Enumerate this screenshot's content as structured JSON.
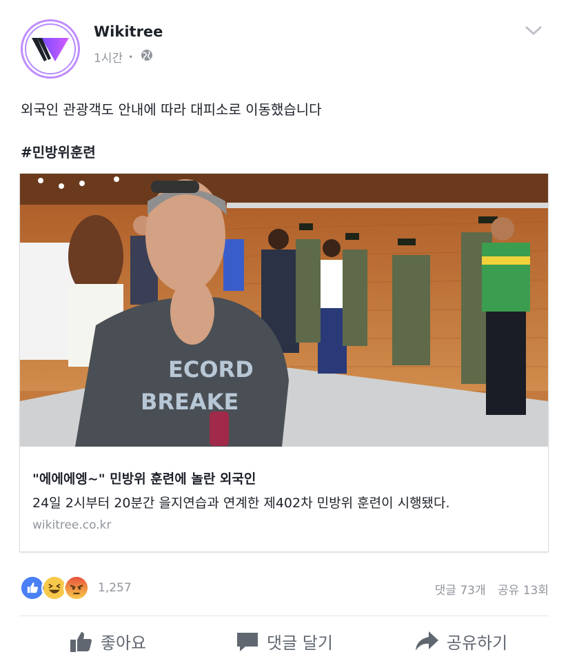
{
  "post": {
    "page_name": "Wikitree",
    "time": "1시간",
    "separator": "•",
    "privacy_icon": "public-globe-icon",
    "text": "외국인 관광객도 안내에 따라 대피소로 이동했습니다",
    "hashtag": "#민방위훈련"
  },
  "link_preview": {
    "image_desc_icon": "news-photo",
    "title": "\"에에에엥~\" 민방위 훈련에 놀란 외국인",
    "description": "24일 2시부터 20분간 을지연습과 연계한 제402차 민방위 훈련이 시행됐다.",
    "domain": "wikitree.co.kr",
    "shirt_text_1": "ECORD",
    "shirt_text_2": "BREAKE"
  },
  "engagement": {
    "reaction_count": "1,257",
    "comments": "댓글 73개",
    "shares": "공유 13회",
    "reaction_icons": [
      "like-icon",
      "haha-icon",
      "angry-icon"
    ]
  },
  "actions": {
    "like": "좋아요",
    "comment": "댓글 달기",
    "share": "공유하기"
  },
  "colors": {
    "like_blue": "#4a80f5",
    "meta_gray": "#90949c",
    "action_gray": "#606770",
    "wood": "#c47a3e"
  }
}
